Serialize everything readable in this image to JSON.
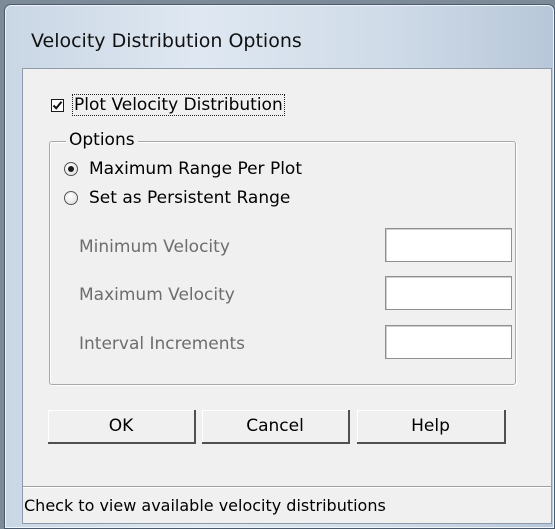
{
  "window": {
    "title": "Velocity Distribution Options"
  },
  "checkbox": {
    "label": "Plot Velocity Distribution",
    "checked": true
  },
  "options_group": {
    "legend": "Options",
    "radios": [
      {
        "label": "Maximum Range Per Plot",
        "selected": true
      },
      {
        "label": "Set as Persistent Range",
        "selected": false
      }
    ],
    "fields": [
      {
        "label": "Minimum Velocity",
        "value": ""
      },
      {
        "label": "Maximum Velocity",
        "value": ""
      },
      {
        "label": "Interval Increments",
        "value": ""
      }
    ]
  },
  "buttons": {
    "ok": "OK",
    "cancel": "Cancel",
    "help": "Help"
  },
  "status_bar": {
    "text": "Check to view available velocity distributions"
  },
  "icons": {
    "checkmark": "check-icon",
    "radio_dot": "radio-selected-icon"
  }
}
